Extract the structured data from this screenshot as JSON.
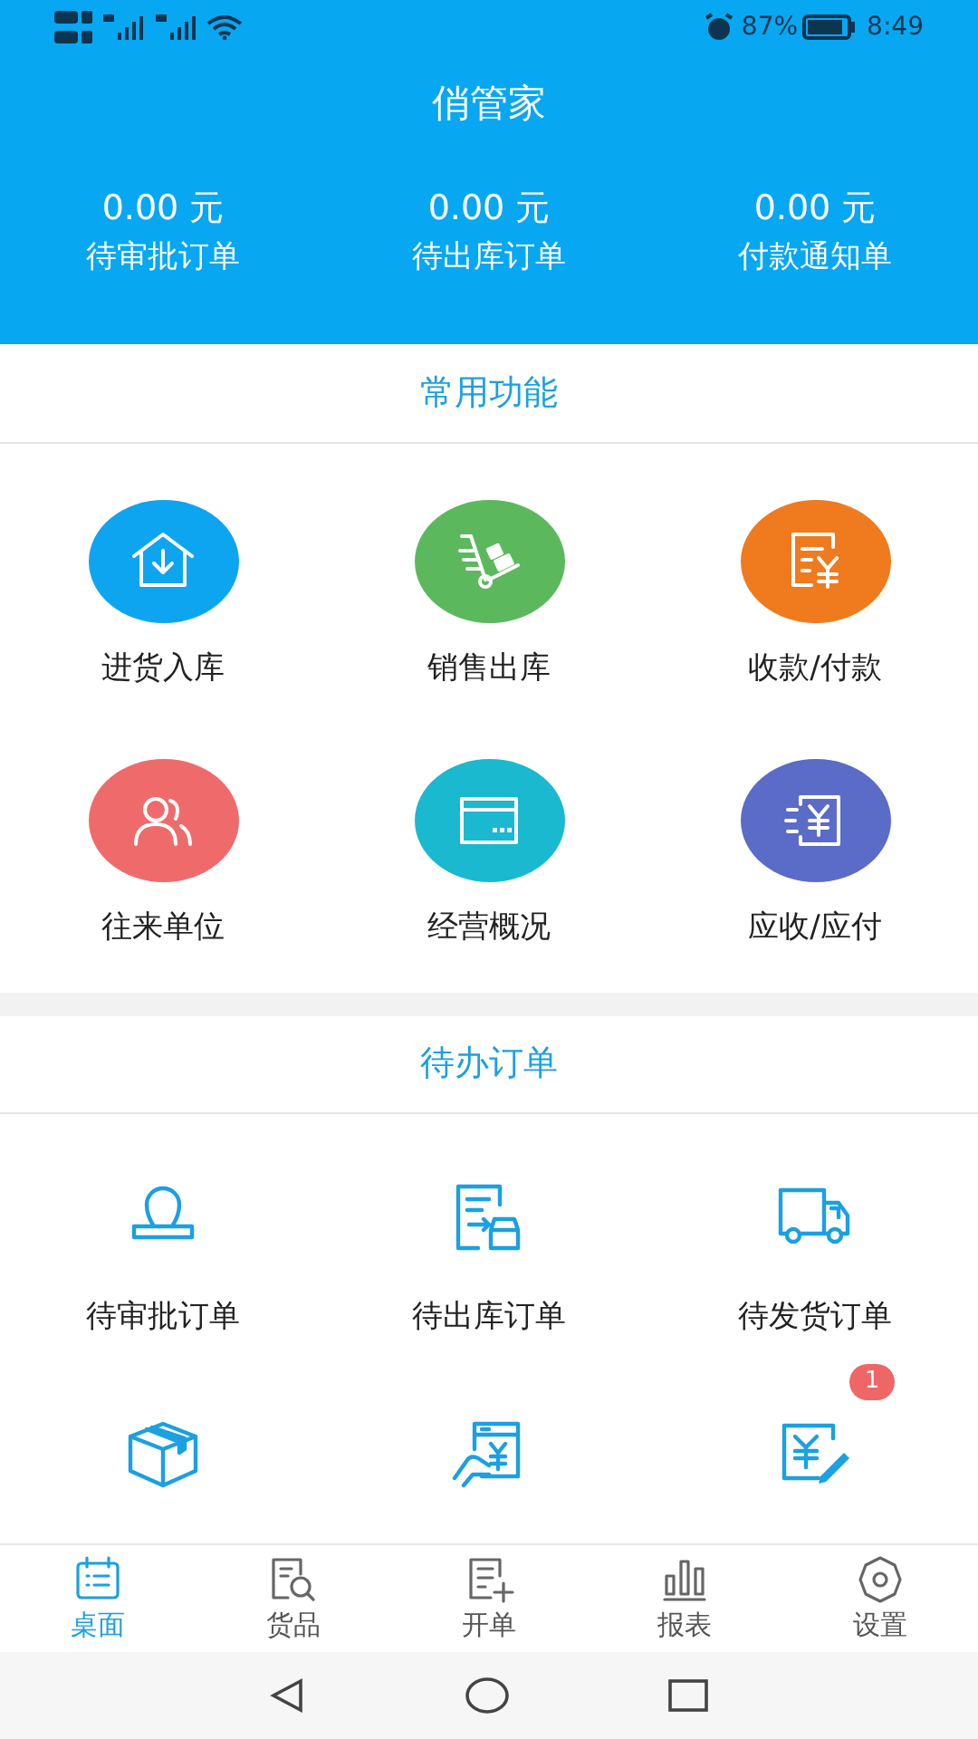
{
  "status_bar": {
    "battery": "87%",
    "time": "8:49"
  },
  "header": {
    "title": "俏管家",
    "stats": [
      {
        "amount": "0.00 元",
        "label": "待审批订单"
      },
      {
        "amount": "0.00 元",
        "label": "待出库订单"
      },
      {
        "amount": "0.00 元",
        "label": "付款通知单"
      }
    ]
  },
  "common_functions": {
    "title": "常用功能",
    "items": [
      {
        "label": "进货入库",
        "color": "#0ea5f0"
      },
      {
        "label": "销售出库",
        "color": "#5cb85c"
      },
      {
        "label": "收款/付款",
        "color": "#f07b1e"
      },
      {
        "label": "往来单位",
        "color": "#ef6b6b"
      },
      {
        "label": "经营概况",
        "color": "#1ab9cf"
      },
      {
        "label": "应收/应付",
        "color": "#5b6bc8"
      }
    ]
  },
  "pending_orders": {
    "title": "待办订单",
    "items": [
      {
        "kind": "labeled",
        "label": "待审批订单"
      },
      {
        "kind": "labeled",
        "label": "待出库订单"
      },
      {
        "kind": "labeled",
        "label": "待发货订单"
      },
      {
        "kind": "icon_only"
      },
      {
        "kind": "icon_only"
      },
      {
        "kind": "icon_only",
        "badge": "1"
      }
    ]
  },
  "bottom_nav": [
    {
      "label": "桌面",
      "selected": true
    },
    {
      "label": "货品",
      "selected": false
    },
    {
      "label": "开单",
      "selected": false
    },
    {
      "label": "报表",
      "selected": false
    },
    {
      "label": "设置",
      "selected": false
    }
  ]
}
